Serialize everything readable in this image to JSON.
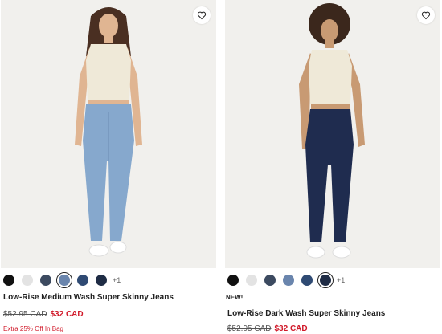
{
  "products": [
    {
      "name": "Low-Rise Medium Wash Super Skinny Jeans",
      "badge": "",
      "original_price": "$52.95 CAD",
      "sale_price": "$32 CAD",
      "promo": "Extra 25% Off In Bag",
      "more_colors": "+1",
      "swatches": [
        "#111111",
        "#e3e3e3",
        "#3c4a60",
        "#6a85ad",
        "#2f4a73",
        "#1f2c45"
      ],
      "selected_swatch": 3,
      "favorite_icon": "heart-outline-icon"
    },
    {
      "name": "Low-Rise Dark Wash Super Skinny Jeans",
      "badge": "NEW!",
      "original_price": "$52.95 CAD",
      "sale_price": "$32 CAD",
      "promo": "",
      "more_colors": "+1",
      "swatches": [
        "#111111",
        "#e3e3e3",
        "#3c4a60",
        "#6a85ad",
        "#2f4a73",
        "#1f2c45"
      ],
      "selected_swatch": 5,
      "favorite_icon": "heart-outline-icon"
    }
  ],
  "colors": {
    "sale": "#d11a2a",
    "photo_bg": "#f1f0ed"
  }
}
